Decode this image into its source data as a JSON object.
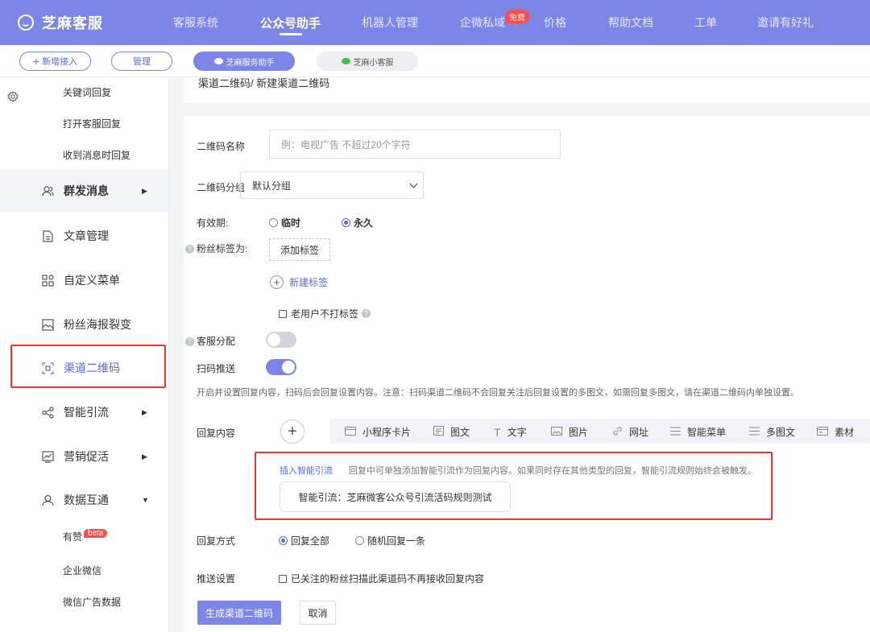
{
  "brand": {
    "name": "芝麻客服",
    "logo_icon": "chat-smile-icon"
  },
  "nav": {
    "items": [
      {
        "label": "客服系统"
      },
      {
        "label": "公众号助手"
      },
      {
        "label": "机器人管理"
      },
      {
        "label": "企微私域",
        "badge": "免费"
      },
      {
        "label": "价格"
      },
      {
        "label": "帮助文档"
      },
      {
        "label": "工单"
      },
      {
        "label": "邀请有好礼"
      }
    ],
    "active_index": 1
  },
  "subbar": {
    "add_label": "新增接入",
    "manage_label": "管理",
    "tabs": [
      {
        "label": "芝麻服务助手"
      },
      {
        "label": "芝麻小客服"
      }
    ]
  },
  "sidebar": {
    "sub_items_top": [
      {
        "label": "关键词回复"
      },
      {
        "label": "打开客服回复"
      },
      {
        "label": "收到消息时回复"
      }
    ],
    "items": [
      {
        "label": "群发消息",
        "icon": "users-icon"
      },
      {
        "label": "文章管理",
        "icon": "document-icon"
      },
      {
        "label": "自定义菜单",
        "icon": "grid-icon"
      },
      {
        "label": "粉丝海报裂变",
        "icon": "image-icon"
      },
      {
        "label": "渠道二维码",
        "icon": "qrcode-scan-icon"
      },
      {
        "label": "智能引流",
        "icon": "share-icon"
      },
      {
        "label": "营销促活",
        "icon": "chart-icon"
      },
      {
        "label": "数据互通",
        "icon": "user-icon"
      }
    ],
    "sub_items_bottom": [
      {
        "label": "有赞",
        "badge": "beta"
      },
      {
        "label": "企业微信"
      },
      {
        "label": "微信广告数据"
      }
    ]
  },
  "breadcrumb": "渠道二维码/ 新建渠道二维码",
  "form": {
    "qr_name_label": "二维码名称",
    "qr_name_placeholder": "例：电视广告 不超过20个字符",
    "qr_group_label": "二维码分组",
    "qr_group_value": "默认分组",
    "validity_label": "有效期:",
    "validity_options": [
      "临时",
      "永久"
    ],
    "validity_selected": 1,
    "fan_tag_label": "粉丝标签为:",
    "add_tag_label": "添加标签",
    "new_tag_label": "新建标签",
    "old_user_no_tag_label": "老用户不打标签",
    "service_assign_label": "客服分配",
    "scan_push_label": "扫码推送",
    "scan_push_tip": "开启并设置回复内容，扫码后会回复设置内容。注意：扫码渠道二维码不会回复关注后回复设置的多图文，如需回复多图文，请在渠道二维码内单独设置。",
    "reply_content_label": "回复内容",
    "reply_tools": [
      {
        "label": "小程序卡片",
        "icon": "miniprogram-card-icon"
      },
      {
        "label": "图文",
        "icon": "article-icon"
      },
      {
        "label": "文字",
        "icon": "text-icon"
      },
      {
        "label": "图片",
        "icon": "picture-icon"
      },
      {
        "label": "网址",
        "icon": "link-icon"
      },
      {
        "label": "智能菜单",
        "icon": "menu-list-icon"
      },
      {
        "label": "多图文",
        "icon": "multi-article-icon"
      },
      {
        "label": "素材",
        "icon": "material-icon"
      }
    ],
    "insert_flow_link": "插入智能引流",
    "insert_flow_desc": "回复中可单独添加智能引流作为回复内容。如果同时存在其他类型的回复，智能引流规则始终会被触发。",
    "flow_card_text": "智能引流：芝麻微客公众号引流活码规则测试",
    "reply_mode_label": "回复方式",
    "reply_mode_options": [
      "回复全部",
      "随机回复一条"
    ],
    "reply_mode_selected": 0,
    "push_setting_label": "推送设置",
    "push_setting_option": "已关注的粉丝扫描此渠道码不再接收回复内容",
    "submit_label": "生成渠道二维码",
    "cancel_label": "取消"
  },
  "colors": {
    "accent": "#7b86e6",
    "link": "#5e6ad8",
    "highlight_border": "#e53935",
    "badge": "#ff4d4f"
  }
}
